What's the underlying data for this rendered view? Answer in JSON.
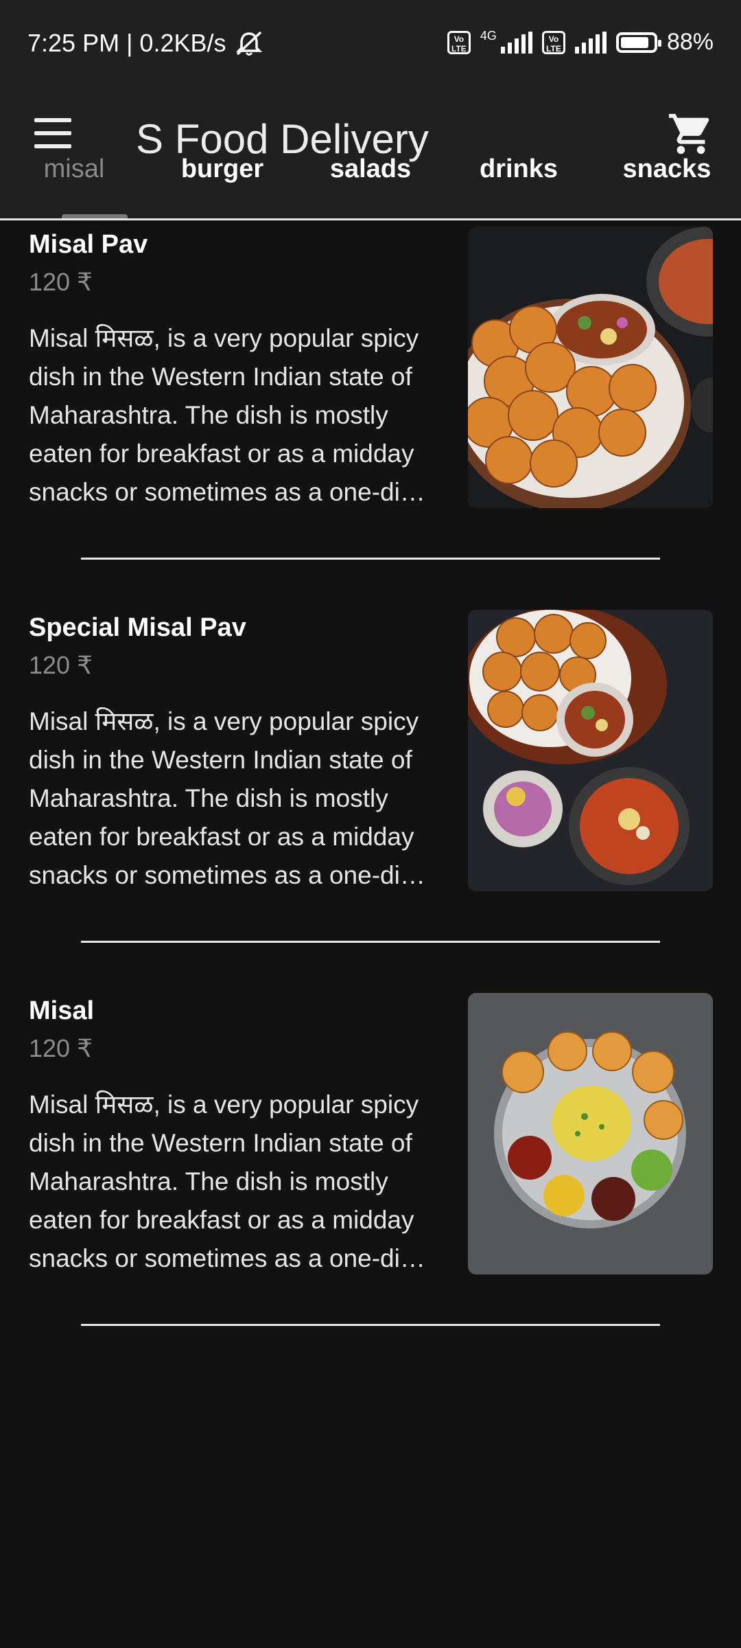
{
  "status_bar": {
    "time_speed": "7:25 PM | 0.2KB/s",
    "network_label": "4G",
    "volte_label": "Vo LTE",
    "battery_percent": "88%",
    "battery_level": 0.88
  },
  "app_bar": {
    "title": "S Food Delivery",
    "menu_icon": "hamburger-menu-icon",
    "cart_icon": "shopping-cart-icon"
  },
  "tabs": [
    {
      "label": "misal",
      "active": true
    },
    {
      "label": "burger",
      "active": false
    },
    {
      "label": "salads",
      "active": false
    },
    {
      "label": "drinks",
      "active": false
    },
    {
      "label": "snacks",
      "active": false
    }
  ],
  "menu_items": [
    {
      "title": "Misal Pav",
      "price": "120 ₹",
      "description": "Misal मिसळ, is a very popular spicy dish in the Western Indian state of Maharashtra. The dish is mostly eaten for breakfast or as a midday snacks or sometimes as a one-di…"
    },
    {
      "title": "Special Misal Pav",
      "price": "120 ₹",
      "description": "Misal मिसळ, is a very popular spicy dish in the Western Indian state of Maharashtra. The dish is mostly eaten for breakfast or as a midday snacks or sometimes as a one-di…"
    },
    {
      "title": "Misal",
      "price": "120 ₹",
      "description": "Misal मिसळ, is a very popular spicy dish in the Western Indian state of Maharashtra. The dish is mostly eaten for breakfast or as a midday snacks or sometimes as a one-di…"
    }
  ],
  "colors": {
    "background": "#121212",
    "app_bar": "#202020",
    "active_tab": "#8a8a8a",
    "price": "#8c8c8c"
  }
}
